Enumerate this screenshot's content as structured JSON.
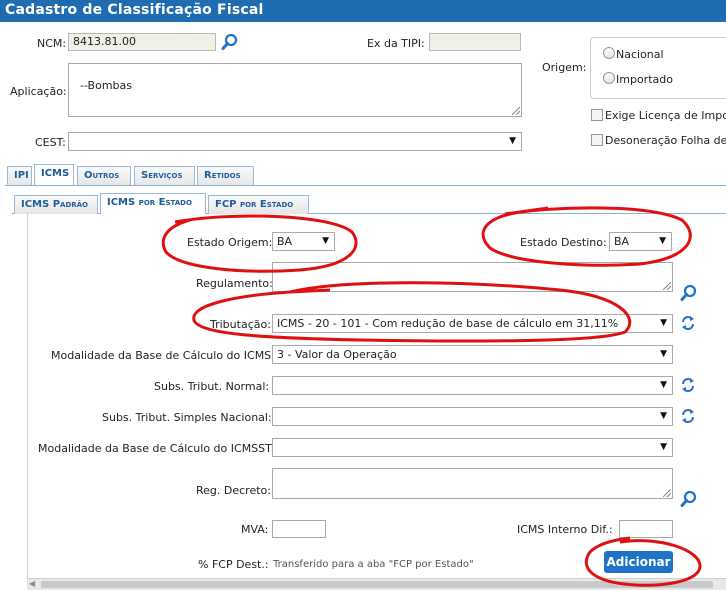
{
  "title": "Cadastro de Classificação Fiscal",
  "form": {
    "ncm_label": "NCM:",
    "ncm_value": "8413.81.00",
    "ex_tipi_label": "Ex da TIPI:",
    "ex_tipi_value": "",
    "aplicacao_label": "Aplicação:",
    "aplicacao_value": "--Bombas",
    "origem_label": "Origem:",
    "origem_options": [
      "Nacional",
      "Importado"
    ],
    "exige_licenca_label": "Exige Licença de Impo",
    "desoneracao_label": "Desoneração Folha de",
    "cest_label": "CEST:",
    "cest_value": ""
  },
  "tabs": {
    "main": [
      "IPI",
      "ICMS",
      "Outros",
      "Serviços",
      "Retidos"
    ],
    "main_active": "ICMS",
    "sub": [
      "ICMS Padrão",
      "ICMS por Estado",
      "FCP por Estado"
    ],
    "sub_active": "ICMS por Estado"
  },
  "icms_estado": {
    "estado_origem_label": "Estado Origem:",
    "estado_origem_value": "BA",
    "estado_destino_label": "Estado Destino:",
    "estado_destino_value": "BA",
    "regulamento_label": "Regulamento:",
    "regulamento_value": "",
    "tributacao_label": "Tributação:",
    "tributacao_value": "ICMS - 20 - 101 - Com redução de base de cálculo em 31,11%",
    "mod_bc_icms_label": "Modalidade da Base de Cálculo do ICMS:",
    "mod_bc_icms_value": "3 - Valor da Operação",
    "subs_normal_label": "Subs. Tribut. Normal:",
    "subs_normal_value": "",
    "subs_simples_label": "Subs. Tribut. Simples Nacional:",
    "subs_simples_value": "",
    "mod_bc_icmsst_label": "Modalidade da Base de Cálculo do ICMSST:",
    "mod_bc_icmsst_value": "",
    "reg_decreto_label": "Reg. Decreto:",
    "reg_decreto_value": "",
    "mva_label": "MVA:",
    "mva_value": "",
    "icms_interno_label": "ICMS Interno Dif.:",
    "icms_interno_value": "",
    "fcp_dest_label": "% FCP Dest.:",
    "fcp_dest_hint": "Transferido para a aba \"FCP por Estado\"",
    "adicionar_label": "Adicionar"
  },
  "colors": {
    "title_bar": "#1f6db0",
    "button": "#1f73c6",
    "annotation": "#e01010",
    "tab_text": "#1f5f9f"
  }
}
